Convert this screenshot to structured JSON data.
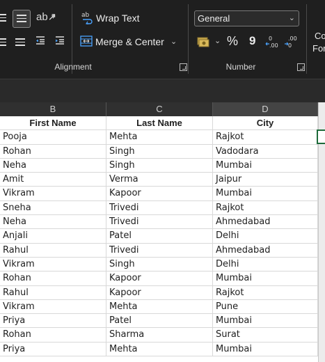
{
  "ribbon": {
    "wrap_text": "Wrap Text",
    "merge_center": "Merge & Center",
    "number_format": "General",
    "percent": "%",
    "comma": "9",
    "decrease_dec": "←.0",
    "increase_dec": ".00",
    "cut_label_1": "Co",
    "cut_label_2": "For",
    "groups": {
      "alignment": "Alignment",
      "number": "Number"
    }
  },
  "columns": [
    "B",
    "C",
    "D"
  ],
  "table": {
    "headers": [
      "First Name",
      "Last Name",
      "City"
    ],
    "rows": [
      [
        "Pooja",
        "Mehta",
        "Rajkot"
      ],
      [
        "Rohan",
        "Singh",
        "Vadodara"
      ],
      [
        "Neha",
        "Singh",
        "Mumbai"
      ],
      [
        "Amit",
        "Verma",
        "Jaipur"
      ],
      [
        "Vikram",
        "Kapoor",
        "Mumbai"
      ],
      [
        "Sneha",
        "Trivedi",
        "Rajkot"
      ],
      [
        "Neha",
        "Trivedi",
        "Ahmedabad"
      ],
      [
        "Anjali",
        "Patel",
        "Delhi"
      ],
      [
        "Rahul",
        "Trivedi",
        "Ahmedabad"
      ],
      [
        "Vikram",
        "Singh",
        "Delhi"
      ],
      [
        "Rohan",
        "Kapoor",
        "Mumbai"
      ],
      [
        "Rahul",
        "Kapoor",
        "Rajkot"
      ],
      [
        "Vikram",
        "Mehta",
        "Pune"
      ],
      [
        "Priya",
        "Patel",
        "Mumbai"
      ],
      [
        "Rohan",
        "Sharma",
        "Surat"
      ],
      [
        "Priya",
        "Mehta",
        "Mumbai"
      ]
    ]
  },
  "colors": {
    "ribbon_bg": "#1f1f1f",
    "grid_line": "#d8d8d8",
    "selection": "#1d6b3a"
  }
}
